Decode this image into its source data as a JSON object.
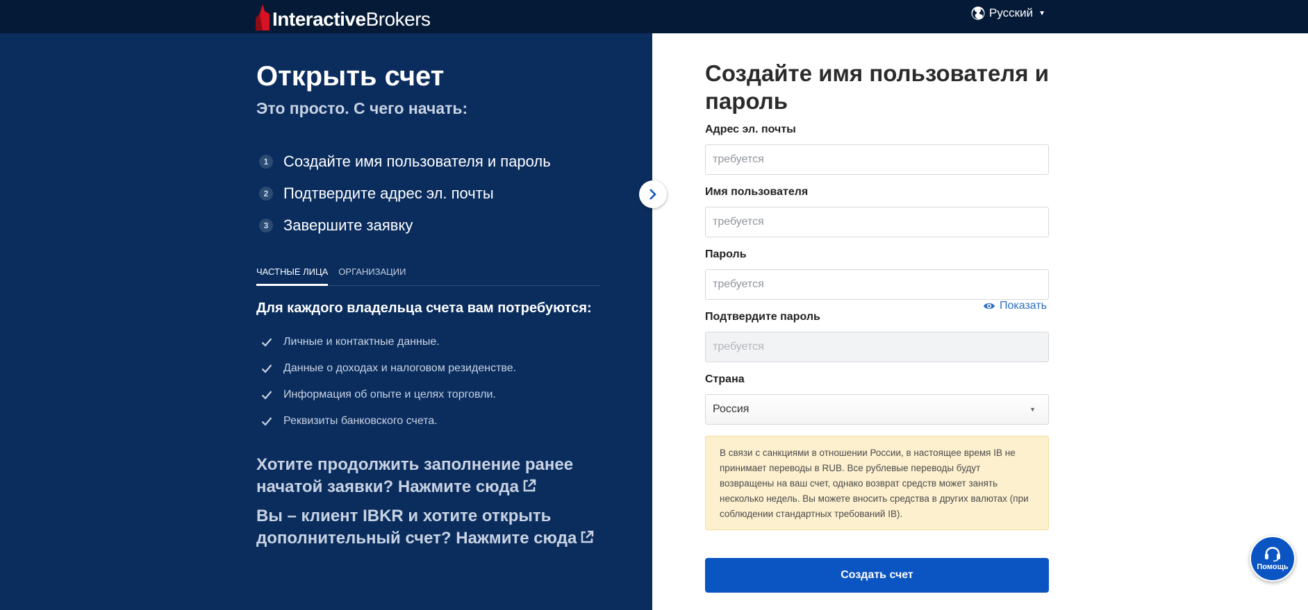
{
  "header": {
    "brand_bold": "Interactive",
    "brand_regular": "Brokers",
    "language": "Русский"
  },
  "left": {
    "title": "Открыть счет",
    "subtitle": "Это просто. С чего начать:",
    "steps": [
      {
        "num": "1",
        "label": "Создайте имя пользователя и пароль"
      },
      {
        "num": "2",
        "label": "Подтвердите адрес эл. почты"
      },
      {
        "num": "3",
        "label": "Завершите заявку"
      }
    ],
    "tabs": [
      {
        "label": "ЧАСТНЫЕ ЛИЦА",
        "active": true
      },
      {
        "label": "ОРГАНИЗАЦИИ",
        "active": false
      }
    ],
    "requirements_title": "Для каждого владельца счета вам потребуются:",
    "requirements": [
      "Личные и контактные данные.",
      "Данные о доходах и налоговом резиденстве.",
      "Информация об опыте и целях торговли.",
      "Реквизиты банковского счета."
    ],
    "link_continue": "Хотите продолжить заполнение ранее начатой заявки? Нажмите сюда",
    "link_existing": "Вы – клиент IBKR и хотите открыть дополнительный счет? Нажмите сюда"
  },
  "form": {
    "title": "Создайте имя пользователя и пароль",
    "email_label": "Адрес эл. почты",
    "email_placeholder": "требуется",
    "username_label": "Имя пользователя",
    "username_placeholder": "требуется",
    "password_label": "Пароль",
    "password_placeholder": "требуется",
    "show_password": "Показать",
    "confirm_label": "Подтвердите пароль",
    "confirm_placeholder": "требуется",
    "country_label": "Страна",
    "country_value": "Россия",
    "notice": "В связи с санкциями в отношении России, в настоящее время IB не принимает переводы в RUB. Все рублевые переводы будут возвращены на ваш счет, однако возврат средств может занять несколько недель. Вы можете вносить средства в других валютах (при соблюдении стандартных требований IB).",
    "submit": "Создать счет"
  },
  "help": {
    "label": "Помощь"
  },
  "colors": {
    "topbar": "#051a36",
    "left_panel": "#0a2d5e",
    "primary": "#0b55c3",
    "notice_bg": "#fdf0cf",
    "logo_red": "#d81222"
  }
}
